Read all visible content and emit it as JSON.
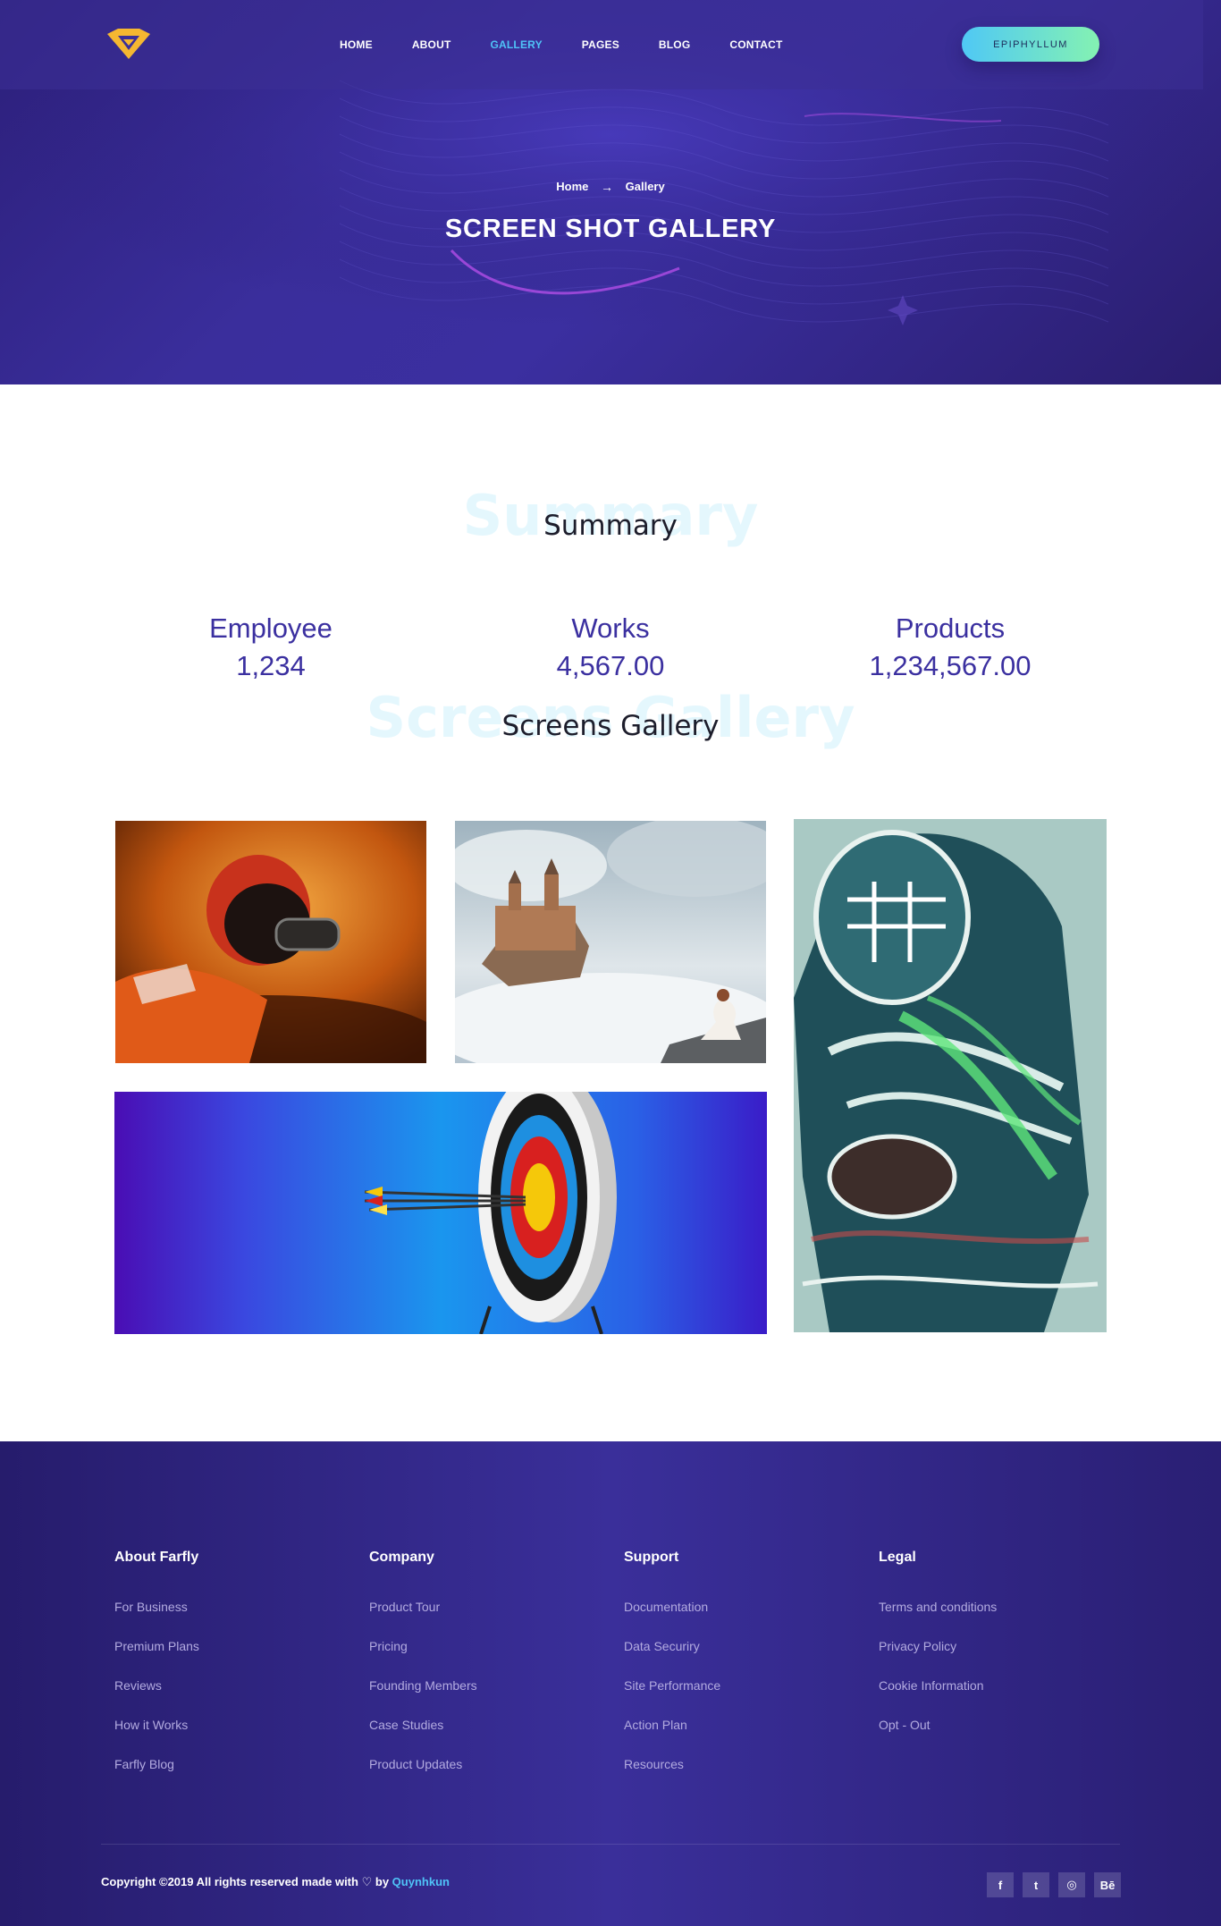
{
  "header": {
    "nav": [
      {
        "label": "HOME",
        "active": false
      },
      {
        "label": "ABOUT",
        "active": false
      },
      {
        "label": "GALLERY",
        "active": true
      },
      {
        "label": "PAGES",
        "active": false
      },
      {
        "label": "BLOG",
        "active": false
      },
      {
        "label": "CONTACT",
        "active": false
      }
    ],
    "cta_label": "EPIPHYLLUM",
    "logo_icon": "diamond-logo-icon",
    "accent_color": "#4fc3f7"
  },
  "hero": {
    "breadcrumb": {
      "home": "Home",
      "separator_icon": "arrow-right-icon",
      "current": "Gallery"
    },
    "title": "SCREEN SHOT GALLERY"
  },
  "summary": {
    "ghost_title": "Summary",
    "title": "Summary",
    "stats": [
      {
        "label": "Employee",
        "value": "1,234"
      },
      {
        "label": "Works",
        "value": "4,567.00"
      },
      {
        "label": "Products",
        "value": "1,234,567.00"
      }
    ]
  },
  "gallery": {
    "ghost_title": "Screens Gallery",
    "title": "Screens Gallery"
  },
  "footer": {
    "columns": [
      {
        "title": "About Farfly",
        "links": [
          "For Business",
          "Premium Plans",
          "Reviews",
          "How it Works",
          "Farfly Blog"
        ]
      },
      {
        "title": "Company",
        "links": [
          "Product Tour",
          "Pricing",
          "Founding Members",
          "Case Studies",
          "Product Updates"
        ]
      },
      {
        "title": "Support",
        "links": [
          "Documentation",
          "Data Securiry",
          "Site Performance",
          "Action Plan",
          "Resources"
        ]
      },
      {
        "title": "Legal",
        "links": [
          "Terms and conditions",
          "Privacy Policy",
          "Cookie Information",
          "Opt - Out"
        ]
      }
    ],
    "copyright_prefix": "Copyright ©2019 All rights reserved made with",
    "heart_icon": "heart-icon",
    "copyright_by": "by",
    "author": "Quynhkun",
    "socials": [
      {
        "icon": "facebook-icon",
        "glyph": "f"
      },
      {
        "icon": "twitter-icon",
        "glyph": "t"
      },
      {
        "icon": "dribbble-icon",
        "glyph": "◎"
      },
      {
        "icon": "behance-icon",
        "glyph": "Bē"
      }
    ]
  }
}
